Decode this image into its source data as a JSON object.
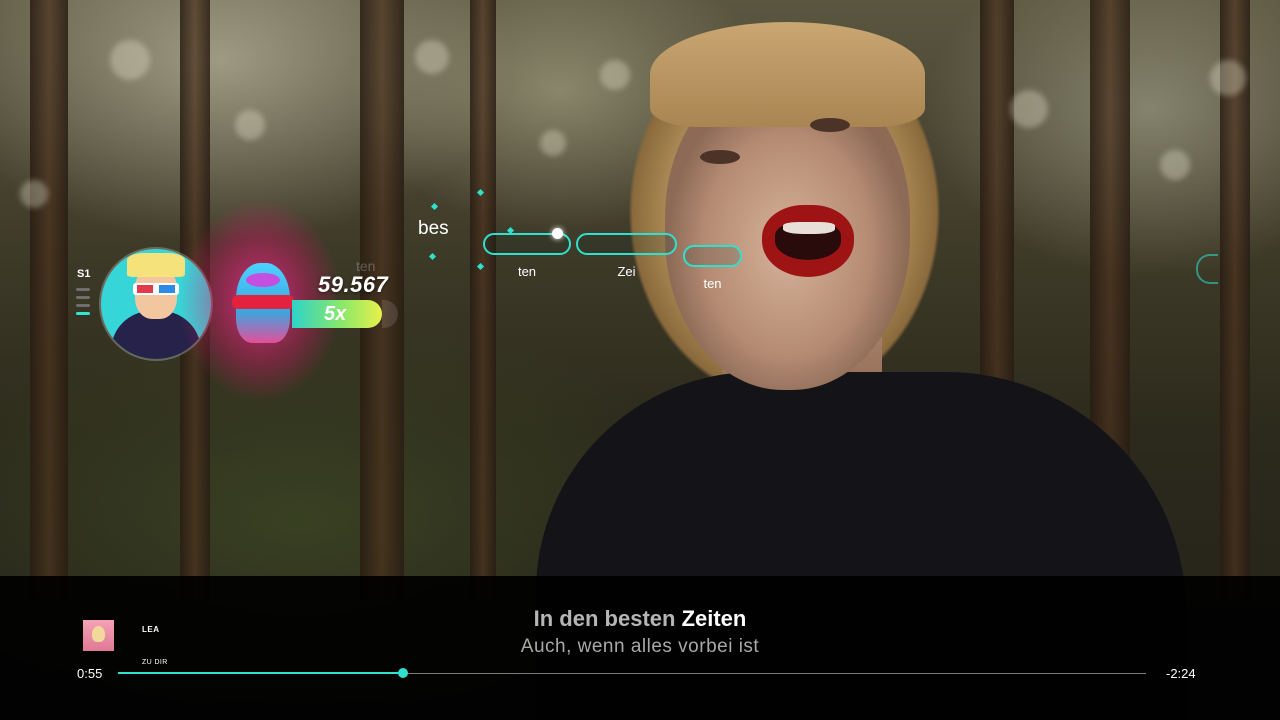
{
  "hud": {
    "player_slot": "S1",
    "score": "59.567",
    "multiplier": "5x",
    "ghost_syllable": "ten"
  },
  "highway": {
    "current_syllable": "bes",
    "notes": [
      {
        "label": "ten"
      },
      {
        "label": "Zei"
      },
      {
        "label": "ten"
      }
    ]
  },
  "now_playing": {
    "artist": "LEA",
    "song": "ZU DIR"
  },
  "lyrics": {
    "current_sung": "In den besten ",
    "current_active": "Zeiten",
    "next_line": "Auch, wenn alles vorbei ist"
  },
  "progress": {
    "elapsed": "0:55",
    "remaining": "-2:24",
    "fraction": 0.277
  },
  "colors": {
    "accent": "#2fe0cf",
    "multiplier_gradient": [
      "#2fd3c9",
      "#8ae86a",
      "#e8f04a"
    ],
    "glow": "#ff2896"
  }
}
